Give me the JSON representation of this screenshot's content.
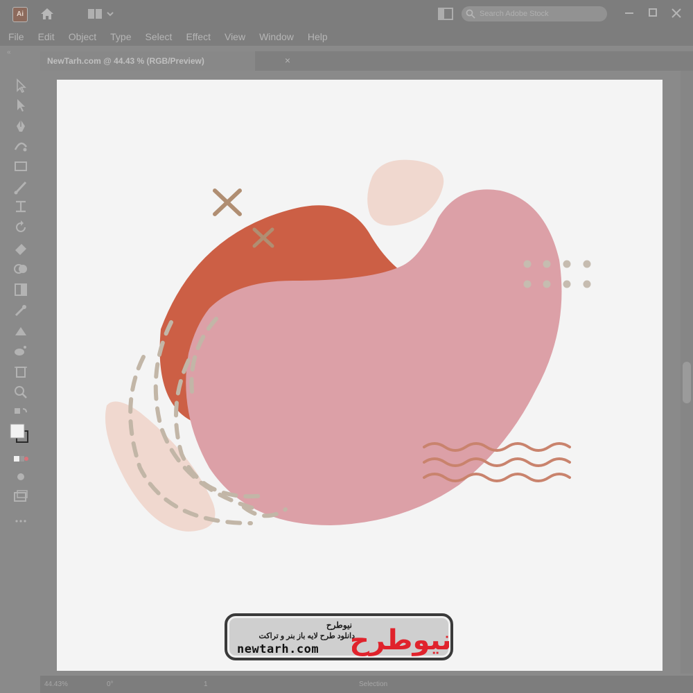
{
  "menu": [
    "File",
    "Edit",
    "Object",
    "Type",
    "Select",
    "Effect",
    "View",
    "Window",
    "Help"
  ],
  "app": {
    "logo_text": "Ai"
  },
  "search": {
    "placeholder": "Search Adobe Stock"
  },
  "document": {
    "tab_title": "NewTarh.com @ 44.43 % (RGB/Preview)",
    "close_label": "×"
  },
  "tools": [
    "selection-tool-icon",
    "direct-selection-tool-icon",
    "pen-tool-icon",
    "curvature-tool-icon",
    "rectangle-tool-icon",
    "paintbrush-tool-icon",
    "width-tool-icon",
    "rotate-tool-icon",
    "eraser-tool-icon",
    "shape-builder-tool-icon",
    "gradient-tool-icon",
    "eyedropper-tool-icon",
    "blend-tool-icon",
    "symbol-sprayer-tool-icon",
    "artboard-tool-icon",
    "zoom-tool-icon"
  ],
  "statusbar": {
    "zoom": "44.43%",
    "rotate": "0°",
    "artboard_nav": "1",
    "current_tool": "Selection"
  },
  "watermark": {
    "brand_fa": "نیوطرح",
    "tagline_fa": "دانلود طرح لایه باز بنر و تراکت",
    "domain": "newtarh.com",
    "logo_text": "نیوطرح"
  },
  "colors": {
    "terracotta": "#cc5f45",
    "pink": "#dca0a7",
    "peach": "#f0d8cf",
    "taupe": "#c2b6a7",
    "x_marks": "#b08e72",
    "waves": "#c9836d",
    "artboard": "#f4f4f4",
    "chrome": "#7d7d7d"
  }
}
